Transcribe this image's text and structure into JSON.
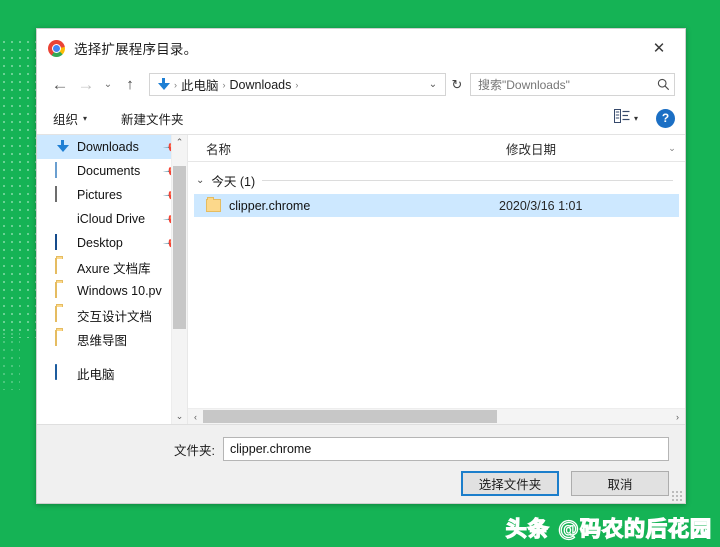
{
  "background": {
    "color": "#15b355",
    "dot_color": "#6fd397"
  },
  "watermark": {
    "text": "头条 @码农的后花园"
  },
  "dialog": {
    "title": "选择扩展程序目录。",
    "app_icon": "chrome-icon",
    "close_label": "✕",
    "nav": {
      "back": "←",
      "forward": "→",
      "recent": "⌄",
      "up": "↑",
      "breadcrumb": {
        "icon": "download-icon",
        "items": [
          "此电脑",
          "Downloads"
        ],
        "separator": "›",
        "trailing_separator": "›",
        "dropdown": "⌄"
      },
      "refresh": "↻",
      "search": {
        "placeholder": "搜索\"Downloads\"",
        "icon": "search-icon"
      }
    },
    "toolbar": {
      "organize": "组织",
      "organize_caret": "▾",
      "new_folder": "新建文件夹",
      "view_caret": "▾",
      "help": "?"
    },
    "sidebar": {
      "items": [
        {
          "label": "Downloads",
          "icon": "download-icon",
          "pinned": true,
          "selected": true
        },
        {
          "label": "Documents",
          "icon": "document-icon",
          "pinned": true,
          "selected": false
        },
        {
          "label": "Pictures",
          "icon": "picture-icon",
          "pinned": true,
          "selected": false
        },
        {
          "label": "iCloud Drive",
          "icon": "cloud-icon",
          "pinned": true,
          "selected": false
        },
        {
          "label": "Desktop",
          "icon": "desktop-icon",
          "pinned": true,
          "selected": false
        },
        {
          "label": "Axure 文档库",
          "icon": "folder-icon",
          "pinned": false,
          "selected": false
        },
        {
          "label": "Windows 10.pv",
          "icon": "folder-icon",
          "pinned": false,
          "selected": false
        },
        {
          "label": "交互设计文档",
          "icon": "folder-icon",
          "pinned": false,
          "selected": false
        },
        {
          "label": "思维导图",
          "icon": "folder-icon",
          "pinned": false,
          "selected": false
        },
        {
          "label": "此电脑",
          "icon": "pc-icon",
          "pinned": false,
          "selected": false
        }
      ],
      "scroll_up": "⌃",
      "scroll_down": "⌄"
    },
    "filelist": {
      "columns": {
        "name": "名称",
        "date": "修改日期",
        "chevron": "⌄"
      },
      "group": {
        "chevron": "⌄",
        "label": "今天 (1)"
      },
      "rows": [
        {
          "name": "clipper.chrome",
          "date": "2020/3/16 1:01",
          "icon": "folder-icon",
          "selected": true
        }
      ],
      "hscroll": {
        "left": "‹",
        "right": "›"
      }
    },
    "footer": {
      "folder_label": "文件夹:",
      "folder_value": "clipper.chrome",
      "select_button": "选择文件夹",
      "cancel_button": "取消"
    }
  }
}
